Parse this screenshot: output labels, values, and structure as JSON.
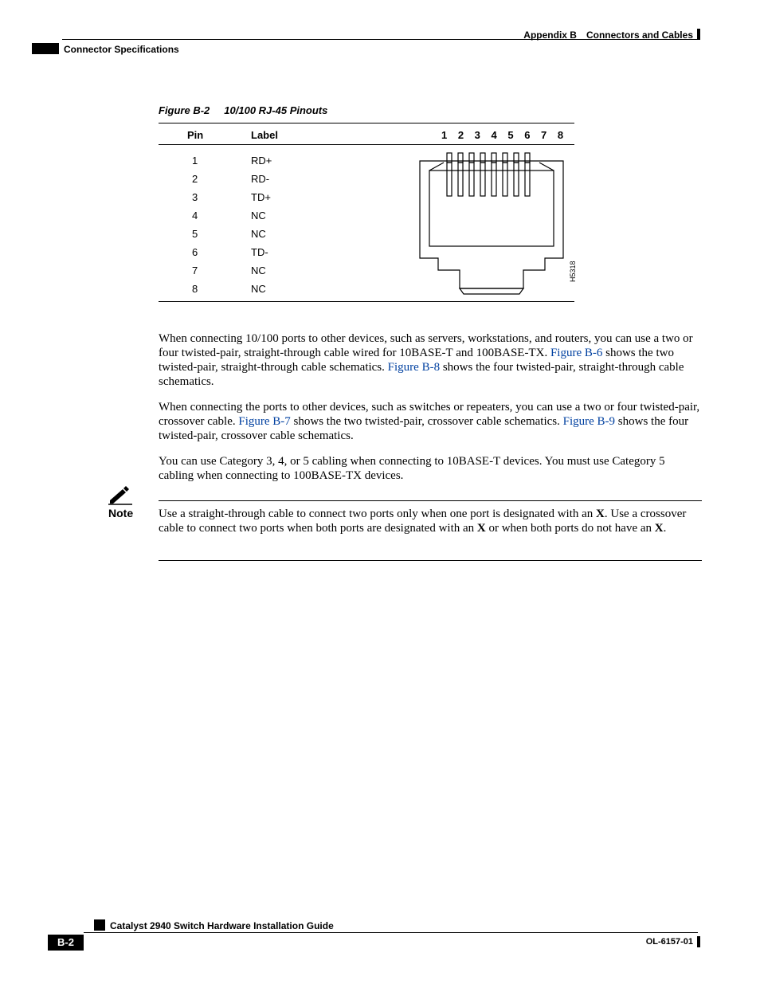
{
  "header": {
    "appendix": "Appendix B Connectors and Cables",
    "section": "Connector Specifications"
  },
  "figure": {
    "caption_id": "Figure B-2",
    "caption_title": "10/100 RJ-45 Pinouts",
    "col_pin": "Pin",
    "col_label": "Label",
    "pin_numbers": "1 2 3 4 5 6 7 8",
    "rows": [
      {
        "pin": "1",
        "label": "RD+"
      },
      {
        "pin": "2",
        "label": "RD-"
      },
      {
        "pin": "3",
        "label": "TD+"
      },
      {
        "pin": "4",
        "label": "NC"
      },
      {
        "pin": "5",
        "label": "NC"
      },
      {
        "pin": "6",
        "label": "TD-"
      },
      {
        "pin": "7",
        "label": "NC"
      },
      {
        "pin": "8",
        "label": "NC"
      }
    ],
    "drawing_id": "H5318"
  },
  "paragraphs": {
    "p1_a": "When connecting 10/100 ports to other devices, such as servers, workstations, and routers, you can use a two or four twisted-pair, straight-through cable wired for 10BASE-T and 100BASE-TX. ",
    "p1_link1": "Figure B-6",
    "p1_b": " shows the two twisted-pair, straight-through cable schematics. ",
    "p1_link2": "Figure B-8",
    "p1_c": " shows the four twisted-pair, straight-through cable schematics.",
    "p2_a": "When connecting the ports to other devices, such as switches or repeaters, you can use a two or four twisted-pair, crossover cable. ",
    "p2_link1": "Figure B-7",
    "p2_b": " shows the two twisted-pair, crossover cable schematics. ",
    "p2_link2": "Figure B-9",
    "p2_c": " shows the four twisted-pair, crossover cable schematics.",
    "p3": "You can use Category 3, 4, or 5 cabling when connecting to 10BASE-T devices. You must use Category 5 cabling when connecting to 100BASE-TX devices."
  },
  "note": {
    "label": "Note",
    "t1": "Use a straight-through cable to connect two ports only when one port is designated with an ",
    "x1": "X",
    "t2": ". Use a crossover cable to connect two ports when both ports are designated with an ",
    "x2": "X",
    "t3": " or when both ports do not have an ",
    "x3": "X",
    "t4": "."
  },
  "footer": {
    "guide": "Catalyst 2940 Switch Hardware Installation Guide",
    "page": "B-2",
    "ol": "OL-6157-01"
  }
}
